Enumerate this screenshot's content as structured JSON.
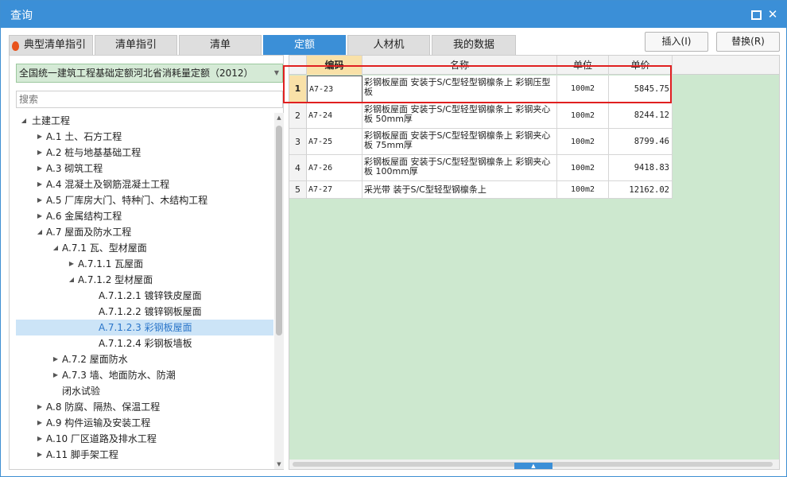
{
  "window": {
    "title": "查询"
  },
  "tabs": [
    {
      "label": "典型清单指引",
      "active": false
    },
    {
      "label": "清单指引",
      "active": false
    },
    {
      "label": "清单",
      "active": false
    },
    {
      "label": "定额",
      "active": true
    },
    {
      "label": "人材机",
      "active": false
    },
    {
      "label": "我的数据",
      "active": false
    }
  ],
  "actions": {
    "insert": "插入(I)",
    "replace": "替换(R)"
  },
  "left": {
    "quota_library": "全国统一建筑工程基础定额河北省消耗量定额（2012）",
    "search_placeholder": "搜索",
    "tree": [
      {
        "label": "土建工程",
        "caret": "expanded",
        "level": 0
      },
      {
        "label": "A.1 土、石方工程",
        "caret": "collapsed",
        "level": 1
      },
      {
        "label": "A.2 桩与地基基础工程",
        "caret": "collapsed",
        "level": 1
      },
      {
        "label": "A.3 砌筑工程",
        "caret": "collapsed",
        "level": 1
      },
      {
        "label": "A.4 混凝土及钢筋混凝土工程",
        "caret": "collapsed",
        "level": 1
      },
      {
        "label": "A.5 厂库房大门、特种门、木结构工程",
        "caret": "collapsed",
        "level": 1
      },
      {
        "label": "A.6 金属结构工程",
        "caret": "collapsed",
        "level": 1
      },
      {
        "label": "A.7 屋面及防水工程",
        "caret": "expanded",
        "level": 1
      },
      {
        "label": "A.7.1 瓦、型材屋面",
        "caret": "expanded",
        "level": 2
      },
      {
        "label": "A.7.1.1 瓦屋面",
        "caret": "collapsed",
        "level": 3
      },
      {
        "label": "A.7.1.2 型材屋面",
        "caret": "expanded",
        "level": 3
      },
      {
        "label": "A.7.1.2.1 镀锌铁皮屋面",
        "caret": "none",
        "level": 4
      },
      {
        "label": "A.7.1.2.2 镀锌钢板屋面",
        "caret": "none",
        "level": 4
      },
      {
        "label": "A.7.1.2.3 彩钢板屋面",
        "caret": "none",
        "level": 4,
        "selected": true
      },
      {
        "label": "A.7.1.2.4 彩钢板墙板",
        "caret": "none",
        "level": 4
      },
      {
        "label": "A.7.2 屋面防水",
        "caret": "collapsed",
        "level": 2
      },
      {
        "label": "A.7.3 墙、地面防水、防潮",
        "caret": "collapsed",
        "level": 2
      },
      {
        "label": "闭水试验",
        "caret": "none",
        "level": 2
      },
      {
        "label": "A.8 防腐、隔热、保温工程",
        "caret": "collapsed",
        "level": 1
      },
      {
        "label": "A.9 构件运输及安装工程",
        "caret": "collapsed",
        "level": 1
      },
      {
        "label": "A.10 厂区道路及排水工程",
        "caret": "collapsed",
        "level": 1
      },
      {
        "label": "A.11 脚手架工程",
        "caret": "collapsed",
        "level": 1
      }
    ]
  },
  "grid": {
    "headers": {
      "code": "编码",
      "name": "名称",
      "unit": "单位",
      "price": "单价"
    },
    "rows": [
      {
        "num": "1",
        "code": "A7-23",
        "name": "彩钢板屋面 安装于S/C型轻型钢檩条上 彩钢压型板",
        "unit": "100m2",
        "price": "5845.75"
      },
      {
        "num": "2",
        "code": "A7-24",
        "name": "彩钢板屋面 安装于S/C型轻型钢檩条上 彩钢夹心板 50mm厚",
        "unit": "100m2",
        "price": "8244.12"
      },
      {
        "num": "3",
        "code": "A7-25",
        "name": "彩钢板屋面 安装于S/C型轻型钢檩条上 彩钢夹心板 75mm厚",
        "unit": "100m2",
        "price": "8799.46"
      },
      {
        "num": "4",
        "code": "A7-26",
        "name": "彩钢板屋面 安装于S/C型轻型钢檩条上 彩钢夹心板 100mm厚",
        "unit": "100m2",
        "price": "9418.83"
      },
      {
        "num": "5",
        "code": "A7-27",
        "name": "采光带 装于S/C型轻型钢檩条上",
        "unit": "100m2",
        "price": "12162.02"
      }
    ]
  },
  "colors": {
    "accent": "#3b8fd7",
    "grid_bg": "#cde8cf",
    "highlight": "#e02020",
    "code_header": "#f9e1a8"
  }
}
